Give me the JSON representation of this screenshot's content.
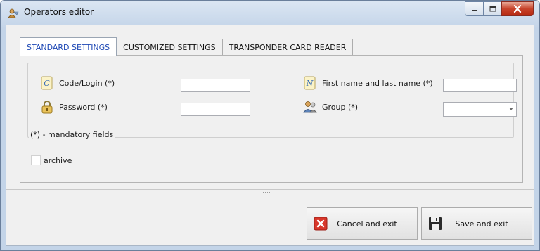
{
  "window": {
    "title": "Operators editor"
  },
  "tabs": [
    {
      "label": "STANDARD SETTINGS",
      "active": true
    },
    {
      "label": "CUSTOMIZED SETTINGS",
      "active": false
    },
    {
      "label": "TRANSPONDER CARD READER",
      "active": false
    }
  ],
  "form": {
    "code_login": {
      "label": "Code/Login (*)",
      "value": ""
    },
    "password": {
      "label": "Password (*)",
      "value": ""
    },
    "first_last_name": {
      "label": "First name and last name (*)",
      "value": ""
    },
    "group": {
      "label": "Group (*)",
      "selected": ""
    },
    "mandatory_note": "(*) - mandatory fields",
    "archive": {
      "label": "archive",
      "checked": false
    }
  },
  "buttons": {
    "cancel": "Cancel and exit",
    "save": "Save and exit"
  },
  "icons": {
    "app": "operator-icon",
    "code": "id-card-icon",
    "password": "padlock-icon",
    "name": "name-card-icon",
    "group": "users-group-icon",
    "cancel": "red-x-icon",
    "save": "floppy-disk-icon"
  },
  "colors": {
    "active_tab_text": "#1f49b5",
    "cancel_icon": "#d8372b",
    "close_button": "#c7432b"
  }
}
